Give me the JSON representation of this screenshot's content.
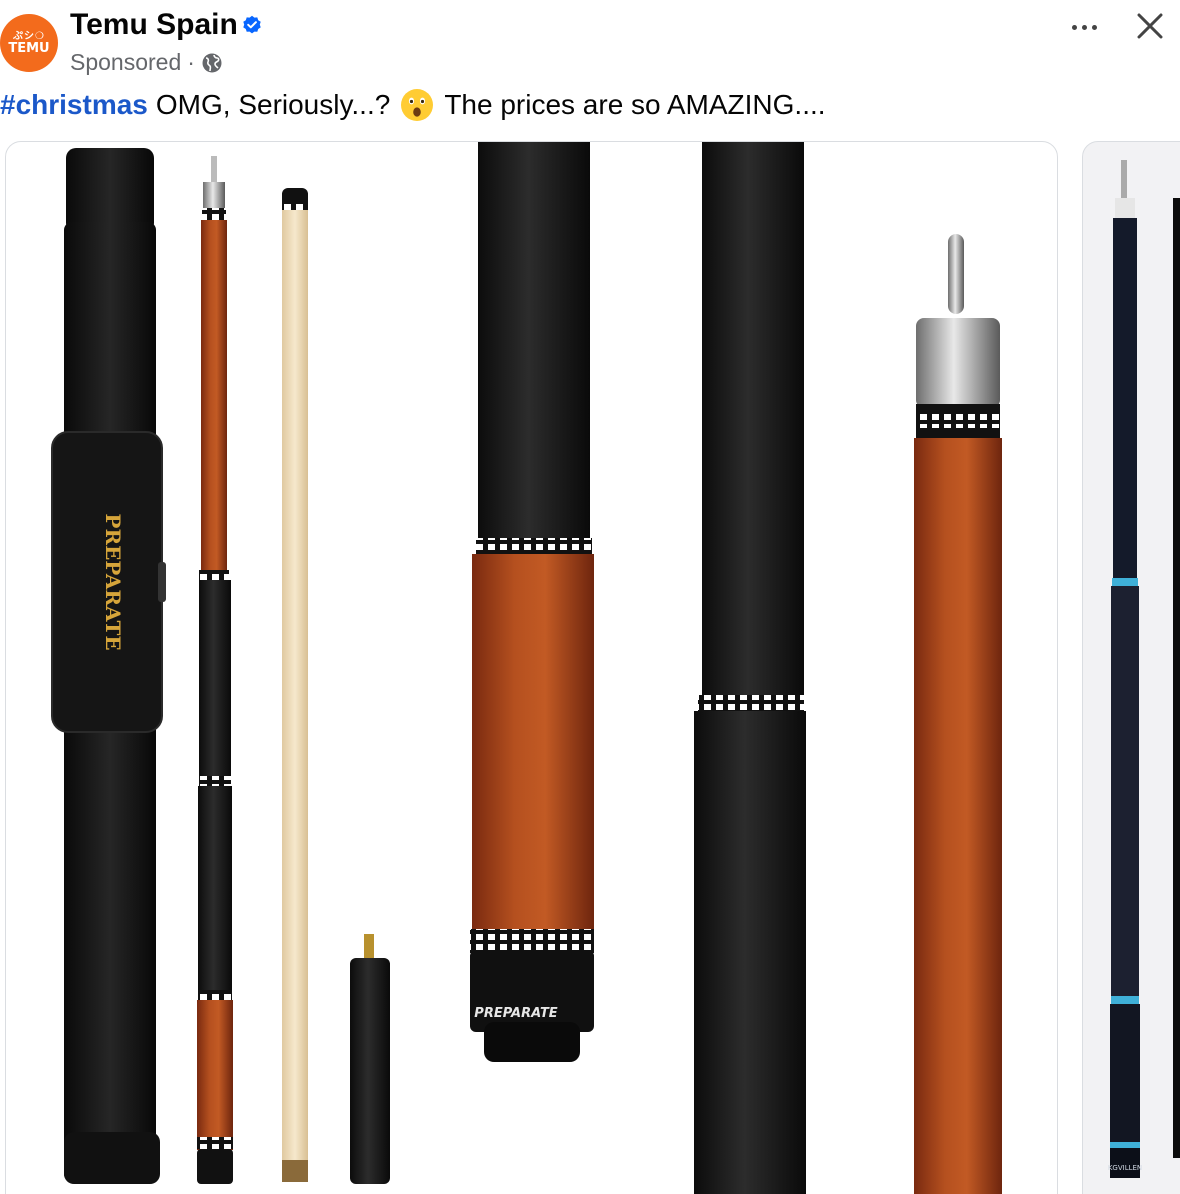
{
  "post": {
    "page_name": "Temu Spain",
    "avatar_text_top": "ぷシ❍",
    "avatar_text_main": "TEMU",
    "sponsored_label": "Sponsored",
    "separator": "·",
    "hashtag": "#christmas",
    "caption_part1": "OMG, Seriously...?",
    "caption_part2": "The prices are so AMAZING....",
    "emoji": "astonished-face"
  },
  "carousel": {
    "card1": {
      "case_brand": "PREPARATE",
      "joint_brand": "PREPARATE"
    },
    "card2": {
      "brand_small": "KGVILLEN"
    }
  },
  "colors": {
    "verified_blue": "#0866ff",
    "hashtag_blue": "#1b58c9",
    "temu_orange": "#f36b1c",
    "wood_red": "#a8421c",
    "grip_black": "#1c1c1c"
  },
  "icons": {
    "verified": "verified-badge-icon",
    "audience": "globe-icon",
    "more": "more-options-icon",
    "close": "close-icon"
  }
}
